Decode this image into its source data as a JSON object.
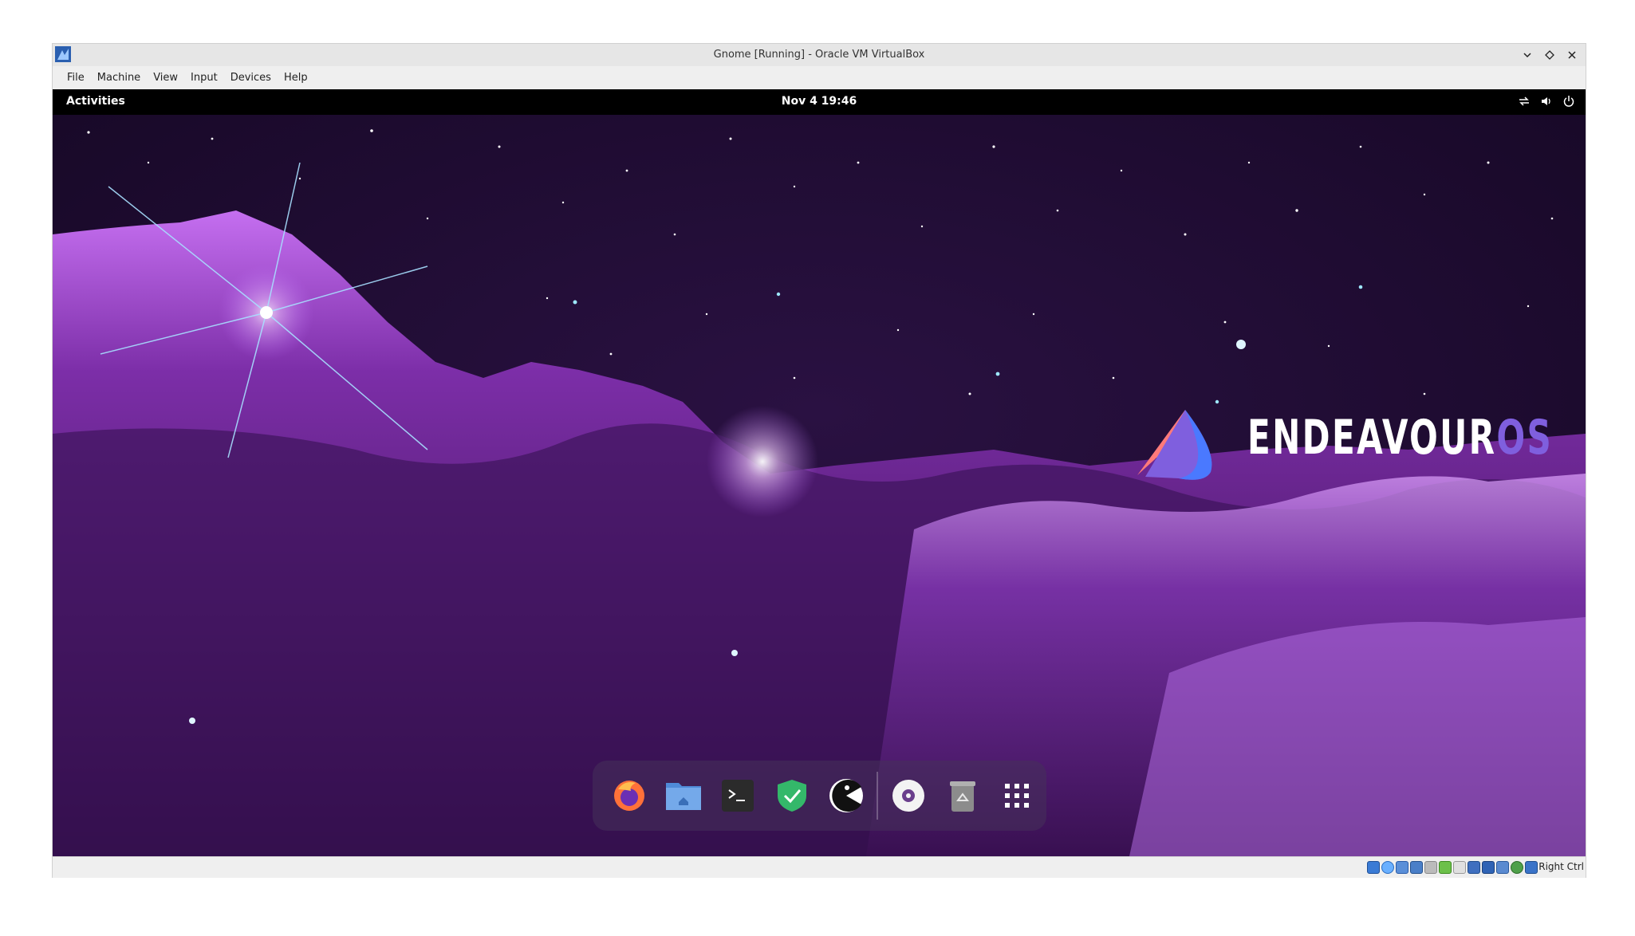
{
  "window": {
    "title": "Gnome [Running] - Oracle VM VirtualBox"
  },
  "menubar": {
    "items": [
      "File",
      "Machine",
      "View",
      "Input",
      "Devices",
      "Help"
    ]
  },
  "gnome": {
    "activities": "Activities",
    "clock": "Nov 4  19:46"
  },
  "logo": {
    "text_main": "ENDEAVOUR",
    "text_os": "OS"
  },
  "dock": {
    "apps": [
      "firefox-icon",
      "files-icon",
      "terminal-icon",
      "security-shield-icon",
      "pacman-icon",
      "disc-icon",
      "trash-icon",
      "app-grid-icon"
    ]
  },
  "statusbar": {
    "host_key": "Right Ctrl"
  },
  "colors": {
    "accent": "#7f5fde",
    "topbar": "#000000",
    "nebula": "#8a3fb8"
  }
}
